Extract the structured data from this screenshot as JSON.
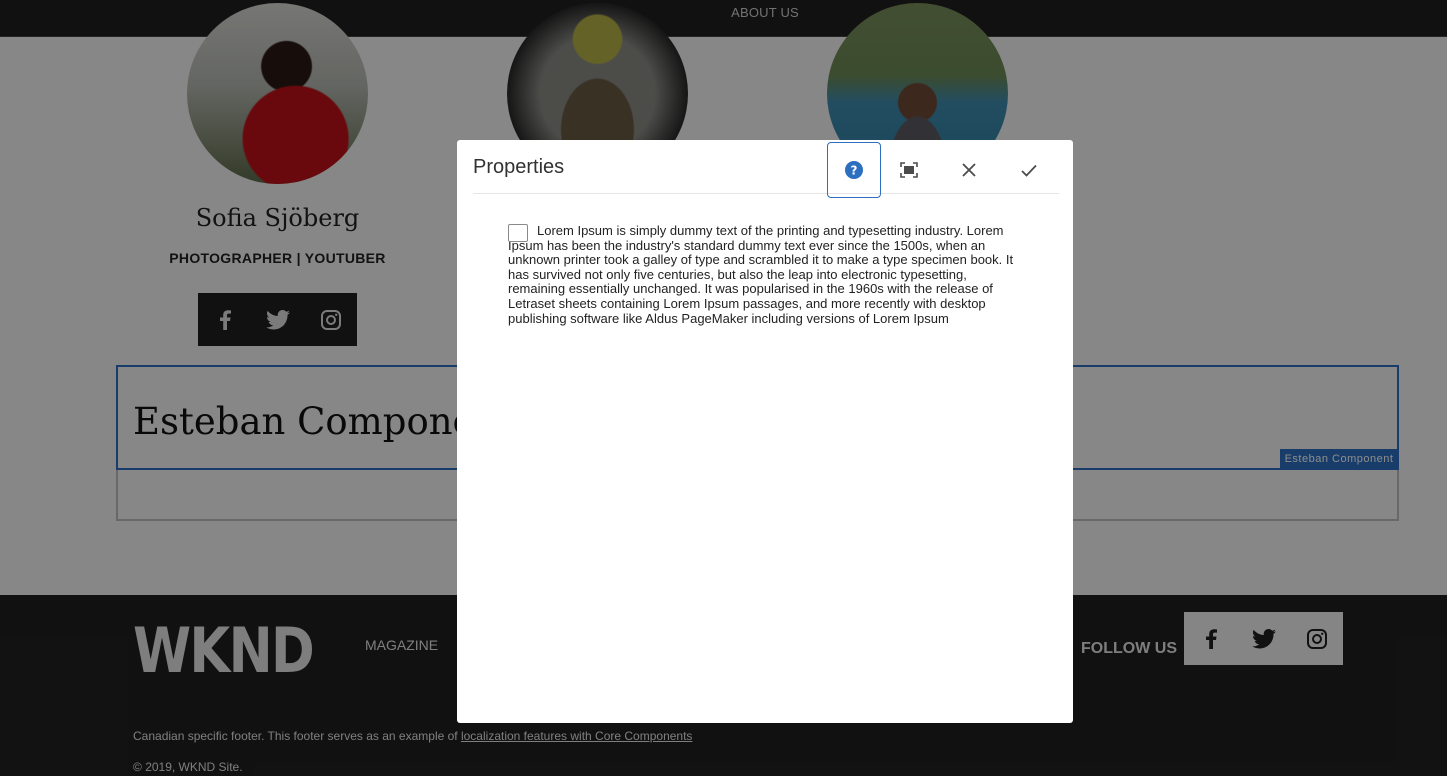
{
  "topnav": {
    "active_item": "ABOUT US"
  },
  "profile": {
    "name": "Sofia Sjöberg",
    "role": "PHOTOGRAPHER | YOUTUBER",
    "social_icons": [
      "facebook-icon",
      "twitter-icon",
      "instagram-icon"
    ]
  },
  "component": {
    "title": "Esteban Component",
    "tag": "Esteban Component",
    "accent": "#2c6fc1"
  },
  "footer": {
    "logo": "WKND",
    "nav_link": "MAGAZINE",
    "follow_us": "FOLLOW US",
    "note_prefix": "Canadian specific footer. This footer serves as an example of",
    "note_link": "localization features with Core Components ",
    "copyright": "2019,  WKND Site.",
    "copyright_symbol": "©"
  },
  "dialog": {
    "title": "Properties",
    "buttons": [
      "help-icon",
      "fullscreen-icon",
      "close-icon",
      "done-icon"
    ],
    "checkbox_checked": false,
    "checkbox_label": "Lorem Ipsum is simply dummy text of the printing and typesetting industry. Lorem Ipsum has been the industry's standard dummy text ever since the 1500s, when an unknown printer took a galley of type and scrambled it to make a type specimen book. It has survived not only five centuries, but also the leap into electronic typesetting, remaining essentially unchanged. It was popularised in the 1960s with the release of Letraset sheets containing Lorem Ipsum passages, and more recently with desktop publishing software like Aldus PageMaker including versions of Lorem Ipsum"
  }
}
